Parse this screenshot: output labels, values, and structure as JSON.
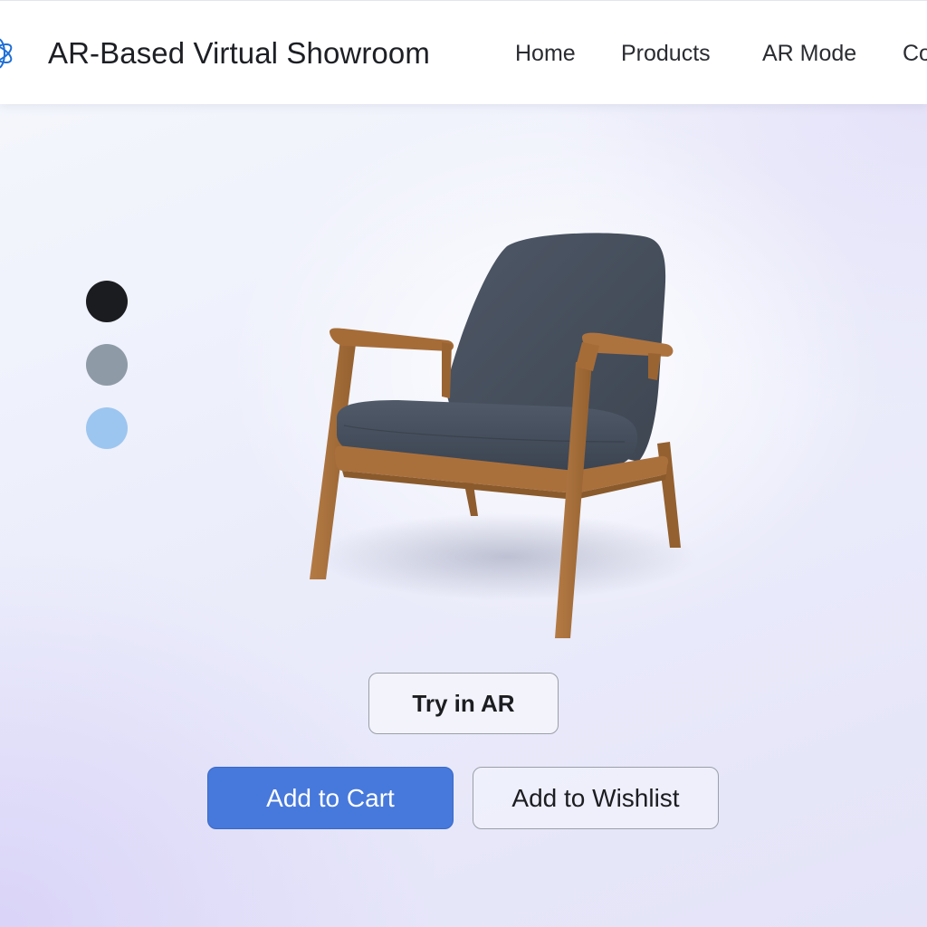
{
  "header": {
    "title": "AR-Based Virtual Showroom",
    "logo_icon": "atom-flower-logo",
    "nav": {
      "home": "Home",
      "products": "Products",
      "ar_mode": "AR Mode",
      "contact": "Co"
    }
  },
  "swatches": [
    {
      "name": "black",
      "color": "#1b1c1f"
    },
    {
      "name": "gray",
      "color": "#8e9aa6"
    },
    {
      "name": "light-blue",
      "color": "#9cc6ef"
    }
  ],
  "product": {
    "image_icon": "armchair-image",
    "upholstery_color": "#464f5d",
    "frame_color": "#a8703f"
  },
  "actions": {
    "try_ar": "Try in AR",
    "add_to_cart": "Add to Cart",
    "add_to_wishlist": "Add to Wishlist"
  },
  "colors": {
    "accent": "#4779dc",
    "logo": "#1f6fd6"
  }
}
